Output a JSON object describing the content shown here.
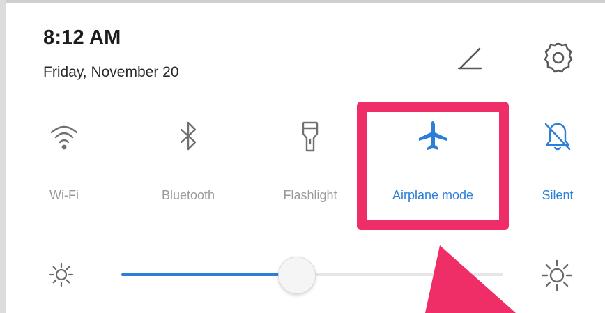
{
  "status": {
    "time": "8:12 AM",
    "date": "Friday, November 20"
  },
  "header_icons": {
    "edit": "edit-pencil-icon",
    "settings": "gear-icon"
  },
  "tiles": [
    {
      "label": "Wi-Fi",
      "icon": "wifi-icon",
      "active": false
    },
    {
      "label": "Bluetooth",
      "icon": "bluetooth-icon",
      "active": false
    },
    {
      "label": "Flashlight",
      "icon": "flashlight-icon",
      "active": false
    },
    {
      "label": "Airplane mode",
      "icon": "airplane-icon",
      "active": true
    },
    {
      "label": "Silent",
      "icon": "bell-off-icon",
      "active": true
    }
  ],
  "brightness": {
    "level": 0.46,
    "low_icon": "sun-low-icon",
    "high_icon": "sun-high-icon"
  },
  "colors": {
    "accent": "#2b7fd9",
    "inactive": "#9a9a9a",
    "highlight": "#ef2e68"
  }
}
